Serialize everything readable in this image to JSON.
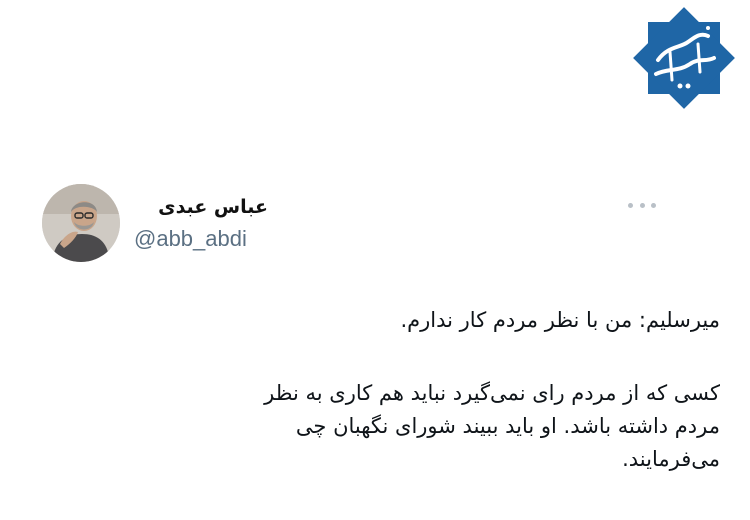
{
  "logo": {
    "caption": "عباس عبدی",
    "color": "#1f66a6"
  },
  "tweet": {
    "author": {
      "display_name": "عباس عبدی",
      "handle": "@abb_abdi"
    },
    "more_icon": "ellipsis-icon",
    "body": {
      "line1": "میرسلیم: من با نظر مردم کار ندارم.",
      "line2": "کسی که از مردم رای نمی‌گیرد نباید هم کاری به نظر",
      "line3": "مردم داشته باشد. او باید ببیند شورای نگهبان چی",
      "line4": "می‌فرمایند."
    }
  },
  "colors": {
    "handle": "#5b7083",
    "text": "#0f1419",
    "dots": "#b9c0c7"
  }
}
